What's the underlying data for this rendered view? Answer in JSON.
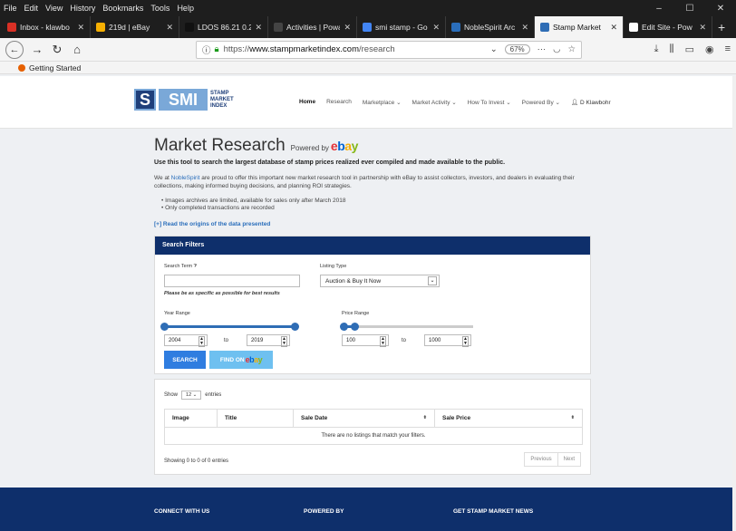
{
  "menubar": {
    "items": [
      "File",
      "Edit",
      "View",
      "History",
      "Bookmarks",
      "Tools",
      "Help"
    ],
    "controls": [
      "–",
      "☐",
      "✕"
    ]
  },
  "tabs": [
    {
      "label": "Inbox - klawbo",
      "color": "#d93025"
    },
    {
      "label": "219d | eBay",
      "color": "#f5af02"
    },
    {
      "label": "LDOS 86.21 0.2",
      "color": "#111111"
    },
    {
      "label": "Activities | Poway",
      "color": "#444444"
    },
    {
      "label": "smi stamp - Go",
      "color": "#4285f4"
    },
    {
      "label": "NobleSpirit Arc",
      "color": "#2a6ebb"
    },
    {
      "label": "Stamp Market",
      "color": "#2f6db5"
    },
    {
      "label": "Edit Site - Pow",
      "color": "#ffffff"
    }
  ],
  "navbar": {
    "url_prefix": "https://",
    "url_host": "www.stampmarketindex.com",
    "url_path": "/research",
    "zoom": "67%",
    "chevron": "⌄",
    "more": "···"
  },
  "bookmarks": {
    "item": "Getting Started"
  },
  "site": {
    "logo_s": "S",
    "logo_smi": "SMI",
    "logo_word1": "STAMP",
    "logo_word2": "MARKET",
    "logo_word3": "INDEX",
    "nav": [
      "Home",
      "Research",
      "Marketplace ⌄",
      "Market Activity ⌄",
      "How To Invest ⌄",
      "Powered By ⌄"
    ],
    "user": "D Klawbohr"
  },
  "main": {
    "title": "Market Research",
    "powered_by": "Powered by",
    "ebay": [
      "e",
      "b",
      "a",
      "y"
    ],
    "lead": "Use this tool to search the largest database of stamp prices realized ever compiled and made available to the public.",
    "intro_pre": "We at ",
    "intro_link": "NobleSpirit",
    "intro_post": " are proud to offer this important new market research tool in partnership with eBay to assist collectors, investors, and dealers in evaluating their collections, making informed buying decisions, and planning ROI strategies.",
    "bullets": [
      "Images archives are limited, available for sales only after March 2018",
      "Only completed transactions are recorded"
    ],
    "origins": "[+] Read the origins of the data presented"
  },
  "filters": {
    "heading": "Search Filters",
    "search_term_label": "Search Term",
    "search_term_value": "",
    "hint": "Please be as specific as possible for best results",
    "listing_type_label": "Listing Type",
    "listing_type_value": "Auction & Buy It Now",
    "year_range_label": "Year Range",
    "year_from": "2004",
    "year_to": "2019",
    "price_range_label": "Price Range",
    "price_from": "100",
    "price_to": "1000",
    "to": "to",
    "search_button": "SEARCH",
    "find_on": "FIND ON"
  },
  "results": {
    "show": "Show",
    "entries_value": "12",
    "entries": "entries",
    "columns": [
      "Image",
      "Title",
      "Sale Date",
      "Sale Price"
    ],
    "empty": "There are no listings that match your filters.",
    "info": "Showing 0 to 0 of 0 entries",
    "prev": "Previous",
    "next": "Next"
  },
  "footer": {
    "connect": "CONNECT WITH US",
    "powered": "POWERED BY",
    "news": "GET STAMP MARKET NEWS"
  }
}
